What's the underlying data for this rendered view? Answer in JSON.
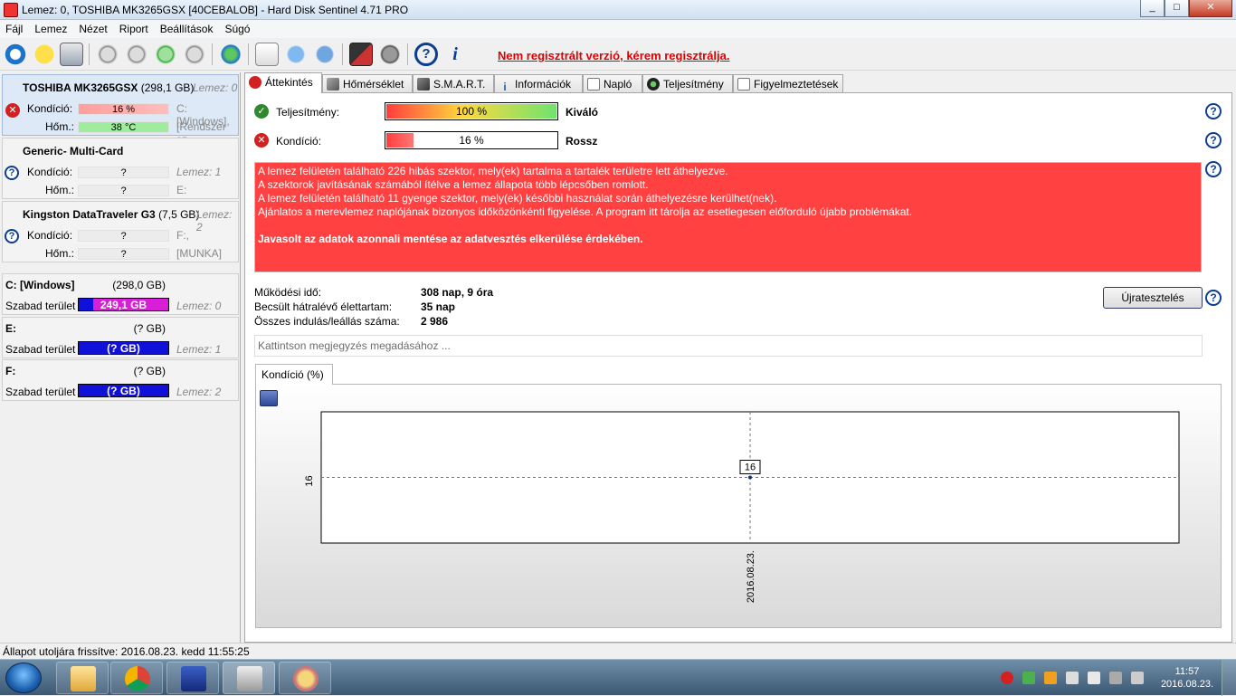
{
  "window": {
    "title": "Lemez: 0, TOSHIBA MK3265GSX [40CEBALOB]  -  Hard Disk Sentinel 4.71 PRO",
    "min": "_",
    "max": "□",
    "close": "✕"
  },
  "menu": [
    "Fájl",
    "Lemez",
    "Nézet",
    "Riport",
    "Beállítások",
    "Súgó"
  ],
  "toolbar": {
    "nag": "Nem regisztrált verzió, kérem regisztrálja."
  },
  "disks": [
    {
      "name": "TOSHIBA MK3265GSX",
      "size": "(298,1 GB)",
      "info": "Lemez: 0",
      "kondicio_label": "Kondíció:",
      "kondicio": "16 %",
      "kondicio_fill": 0.16,
      "hom_label": "Hőm.:",
      "hom": "38 °C",
      "side1": "C: [Windows],",
      "side2": "[Rendszer sz"
    },
    {
      "name": "Generic- Multi-Card",
      "size": "",
      "info": "",
      "kondicio_label": "Kondíció:",
      "kondicio": "?",
      "hom_label": "Hőm.:",
      "hom": "?",
      "side1": "Lemez: 1",
      "side2": "E:"
    },
    {
      "name": "Kingston DataTraveler G3",
      "size": "(7,5 GB)",
      "info": "Lemez: 2",
      "kondicio_label": "Kondíció:",
      "kondicio": "?",
      "hom_label": "Hőm.:",
      "hom": "?",
      "side1": "F:,",
      "side2": "[MUNKA]"
    }
  ],
  "volumes": [
    {
      "name": "C: [Windows]",
      "size": "(298,0 GB)",
      "free_label": "Szabad terület",
      "free": "249,1 GB",
      "disk": "Lemez: 0",
      "used_fill": 0.84
    },
    {
      "name": "E:",
      "size": "(? GB)",
      "free_label": "Szabad terület",
      "free": "(? GB)",
      "disk": "Lemez: 1"
    },
    {
      "name": "F:",
      "size": "(? GB)",
      "free_label": "Szabad terület",
      "free": "(? GB)",
      "disk": "Lemez: 2"
    }
  ],
  "tabs": [
    "Áttekintés",
    "Hőmérséklet",
    "S.M.A.R.T.",
    "Információk",
    "Napló",
    "Teljesítmény",
    "Figyelmeztetések"
  ],
  "overview": {
    "perf_label": "Teljesítmény:",
    "perf_value": "100 %",
    "perf_fill": 1.0,
    "perf_rating": "Kiváló",
    "health_label": "Kondíció:",
    "health_value": "16 %",
    "health_fill": 0.16,
    "health_rating": "Rossz",
    "alert_lines": [
      "A lemez felületén található 226 hibás szektor, mely(ek) tartalma a tartalék területre lett áthelyezve.",
      "A szektorok javításának számából ítélve a lemez állapota több lépcsőben romlott.",
      "A lemez felületén található 11 gyenge szektor, mely(ek) későbbi használat során áthelyezésre kerülhet(nek).",
      "Ajánlatos a merevlemez naplójának bizonyos időközönkénti figyelése. A program itt tárolja az esetlegesen előforduló újabb problémákat."
    ],
    "alert_bold": "Javasolt az adatok azonnali mentése az adatvesztés elkerülése érdekében.",
    "uptime_label": "Működési idő:",
    "uptime": "308 nap, 9 óra",
    "life_label": "Becsült hátralévő élettartam:",
    "life": "35 nap",
    "starts_label": "Összes indulás/leállás száma:",
    "starts": "2 986",
    "retest": "Újratesztelés",
    "note_placeholder": "Kattintson megjegyzés megadásához ...",
    "chart_tab": "Kondíció  (%)"
  },
  "chart_data": {
    "type": "line",
    "x": [
      "2016.08.23."
    ],
    "series": [
      {
        "values": [
          16
        ]
      }
    ],
    "xlabel": "",
    "ylabel": "",
    "y_ticks": [
      "16"
    ],
    "x_ticks": [
      "2016.08.23."
    ],
    "data_labels": [
      "16"
    ],
    "grid": true
  },
  "status": {
    "text": "Állapot utoljára frissítve: 2016.08.23. kedd 11:55:25"
  },
  "clock": {
    "time": "11:57",
    "date": "2016.08.23."
  }
}
